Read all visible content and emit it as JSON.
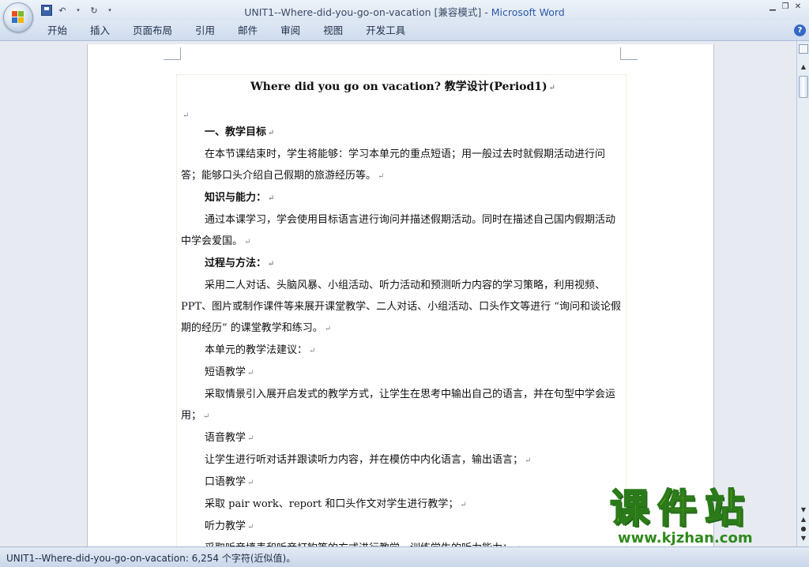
{
  "window": {
    "title_doc": "UNIT1--Where-did-you-go-on-vacation [兼容模式]",
    "title_sep": " - ",
    "title_app": "Microsoft Word"
  },
  "ribbon": {
    "tabs": [
      "开始",
      "插入",
      "页面布局",
      "引用",
      "邮件",
      "审阅",
      "视图",
      "开发工具"
    ]
  },
  "document": {
    "title": "Where did you go on vacation? 教学设计(Period1)",
    "paragraphs": [
      {
        "text": "一、教学目标",
        "bold": true
      },
      {
        "text": "在本节课结束时，学生将能够：学习本单元的重点短语；用一般过去时就假期活动进行问答；能够口头介绍自己假期的旅游经历等。"
      },
      {
        "text": "知识与能力：",
        "bold": true
      },
      {
        "text": "通过本课学习，学会使用目标语言进行询问并描述假期活动。同时在描述自己国内假期活动中学会爱国。"
      },
      {
        "text": "过程与方法：",
        "bold": true
      },
      {
        "text": "采用二人对话、头脑风暴、小组活动、听力活动和预测听力内容的学习策略，利用视频、PPT、图片或制作课件等来展开课堂教学、二人对话、小组活动、口头作文等进行 “询问和谈论假期的经历” 的课堂教学和练习。"
      },
      {
        "text": "本单元的教学法建议："
      },
      {
        "text": "短语教学"
      },
      {
        "text": "采取情景引入展开启发式的教学方式，让学生在思考中输出自己的语言，并在句型中学会运用；"
      },
      {
        "text": "语音教学"
      },
      {
        "text": "让学生进行听对话并跟读听力内容，并在模仿中内化语言，输出语言；"
      },
      {
        "text": "口语教学"
      },
      {
        "text": "采取  pair work、report 和口头作文对学生进行教学；"
      },
      {
        "text": "听力教学"
      },
      {
        "text": "采取听音填表和听音打钩等的方式进行教学，训练学生的听力能力；"
      }
    ],
    "para_mark": "↵"
  },
  "status": {
    "text": "UNIT1--Where-did-you-go-on-vacation: 6,254 个字符(近似值)。"
  },
  "watermark": {
    "cn": "课件站",
    "url": "www.kjzhan.com"
  },
  "icons": {
    "office": "office-button-icon",
    "save": "save-icon",
    "undo": "undo-icon",
    "redo": "redo-icon",
    "help": "help-icon"
  }
}
